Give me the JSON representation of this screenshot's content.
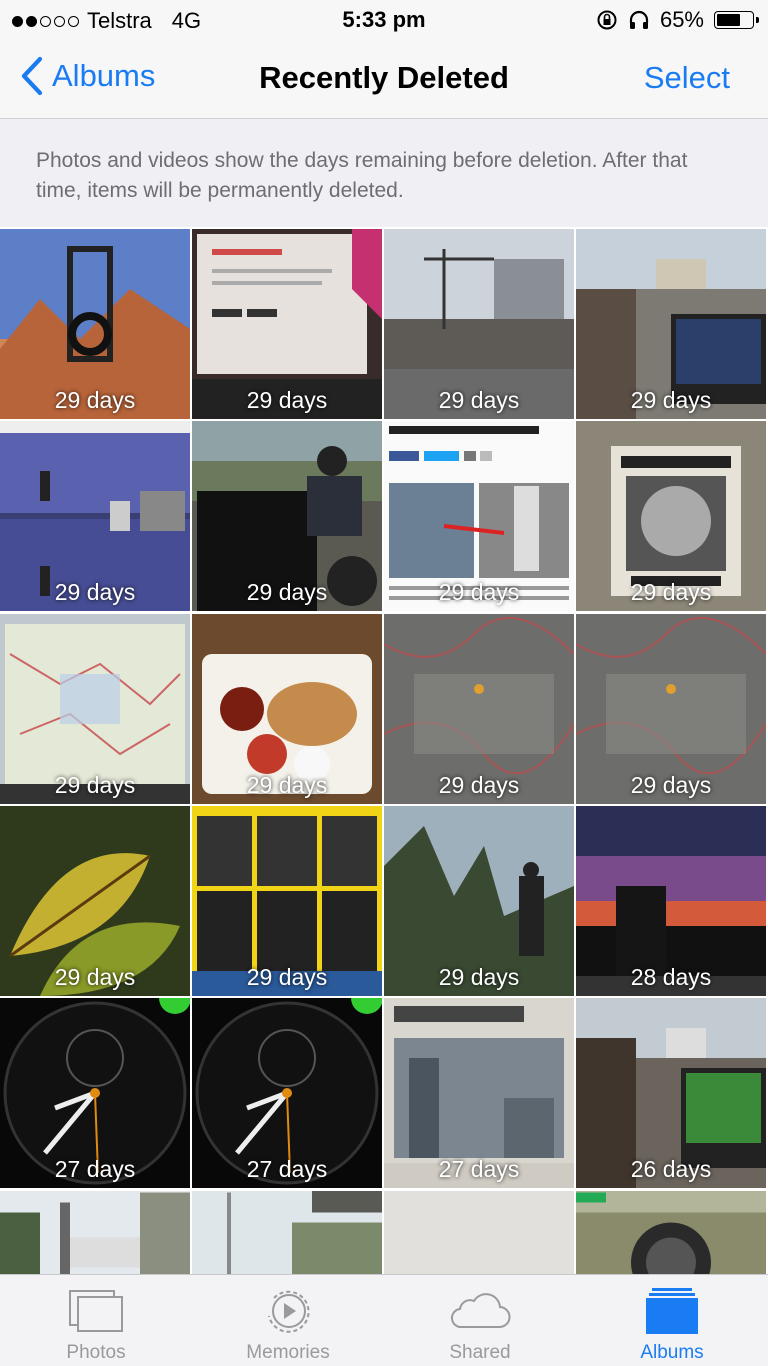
{
  "status_bar": {
    "carrier": "Telstra",
    "network": "4G",
    "time": "5:33 pm",
    "battery": "65%",
    "signal_bars": 2,
    "battery_level": 0.65
  },
  "nav": {
    "back_label": "Albums",
    "title": "Recently Deleted",
    "select_label": "Select"
  },
  "info_text": "Photos and videos show the days remaining before deletion. After that time, items will be permanently deleted.",
  "photos": [
    {
      "label": "29 days",
      "icon": "desert-landscape"
    },
    {
      "label": "29 days",
      "icon": "laptop-webpage"
    },
    {
      "label": "29 days",
      "icon": "city-construction"
    },
    {
      "label": "29 days",
      "icon": "cafe-laptop-street"
    },
    {
      "label": "29 days",
      "icon": "game-screen-text"
    },
    {
      "label": "29 days",
      "icon": "cafe-man-laptop"
    },
    {
      "label": "29 days",
      "icon": "news-article"
    },
    {
      "label": "29 days",
      "icon": "sticker-poster"
    },
    {
      "label": "29 days",
      "icon": "map-screen"
    },
    {
      "label": "29 days",
      "icon": "food-tray"
    },
    {
      "label": "29 days",
      "icon": "terrain-map"
    },
    {
      "label": "29 days",
      "icon": "terrain-map"
    },
    {
      "label": "29 days",
      "icon": "leaf-plant"
    },
    {
      "label": "29 days",
      "icon": "football-players"
    },
    {
      "label": "29 days",
      "icon": "forest-soldier"
    },
    {
      "label": "28 days",
      "icon": "sunset-silhouette"
    },
    {
      "label": "27 days",
      "icon": "stopwatch-face"
    },
    {
      "label": "27 days",
      "icon": "stopwatch-face"
    },
    {
      "label": "27 days",
      "icon": "newspaper-southbank"
    },
    {
      "label": "26 days",
      "icon": "cafe-laptop-football"
    },
    {
      "label": "",
      "icon": "street-scene"
    },
    {
      "label": "",
      "icon": "overcast-sky"
    },
    {
      "label": "",
      "icon": "blank-page"
    },
    {
      "label": "",
      "icon": "game-scope"
    }
  ],
  "tabs": [
    {
      "label": "Photos",
      "icon": "photos-icon",
      "active": false
    },
    {
      "label": "Memories",
      "icon": "memories-icon",
      "active": false
    },
    {
      "label": "Shared",
      "icon": "cloud-icon",
      "active": false
    },
    {
      "label": "Albums",
      "icon": "albums-icon",
      "active": true
    }
  ],
  "colors": {
    "accent": "#1a7cf2",
    "inactive_tab": "#9a9a9e",
    "banner_bg": "#efeff4"
  }
}
